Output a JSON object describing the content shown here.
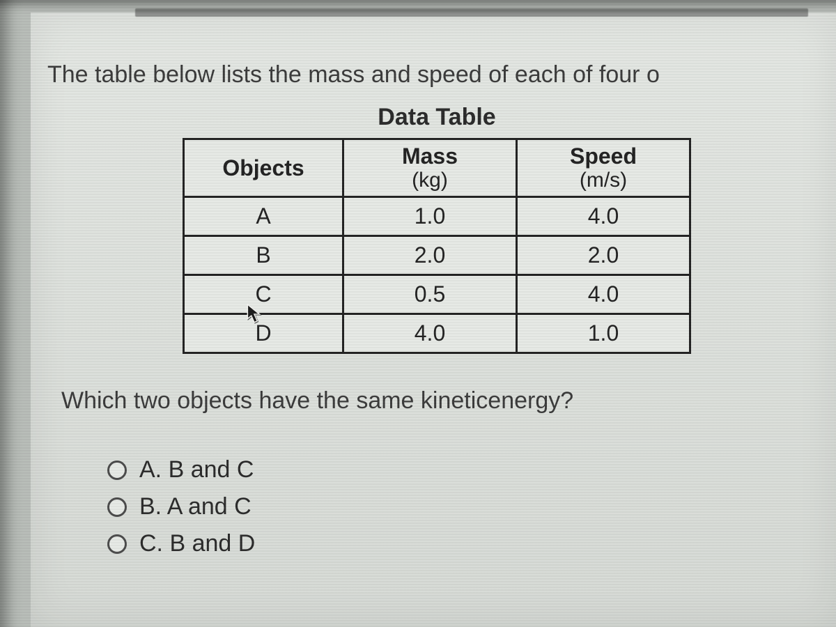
{
  "intro_text": "The table below lists the mass and speed of each of four o",
  "table_title": "Data Table",
  "table": {
    "headers": {
      "objects": "Objects",
      "mass": "Mass",
      "mass_unit": "(kg)",
      "speed": "Speed",
      "speed_unit": "(m/s)"
    },
    "rows": [
      {
        "object": "A",
        "mass": "1.0",
        "speed": "4.0"
      },
      {
        "object": "B",
        "mass": "2.0",
        "speed": "2.0"
      },
      {
        "object": "C",
        "mass": "0.5",
        "speed": "4.0"
      },
      {
        "object": "D",
        "mass": "4.0",
        "speed": "1.0"
      }
    ]
  },
  "question_text": "Which two objects have the same kineticenergy?",
  "options": [
    {
      "letter": "A.",
      "text": "B and C"
    },
    {
      "letter": "B.",
      "text": "A and C"
    },
    {
      "letter": "C.",
      "text": "B and D"
    }
  ],
  "chart_data": {
    "type": "table",
    "title": "Data Table",
    "columns": [
      "Objects",
      "Mass (kg)",
      "Speed (m/s)"
    ],
    "rows": [
      [
        "A",
        1.0,
        4.0
      ],
      [
        "B",
        2.0,
        2.0
      ],
      [
        "C",
        0.5,
        4.0
      ],
      [
        "D",
        4.0,
        1.0
      ]
    ]
  }
}
